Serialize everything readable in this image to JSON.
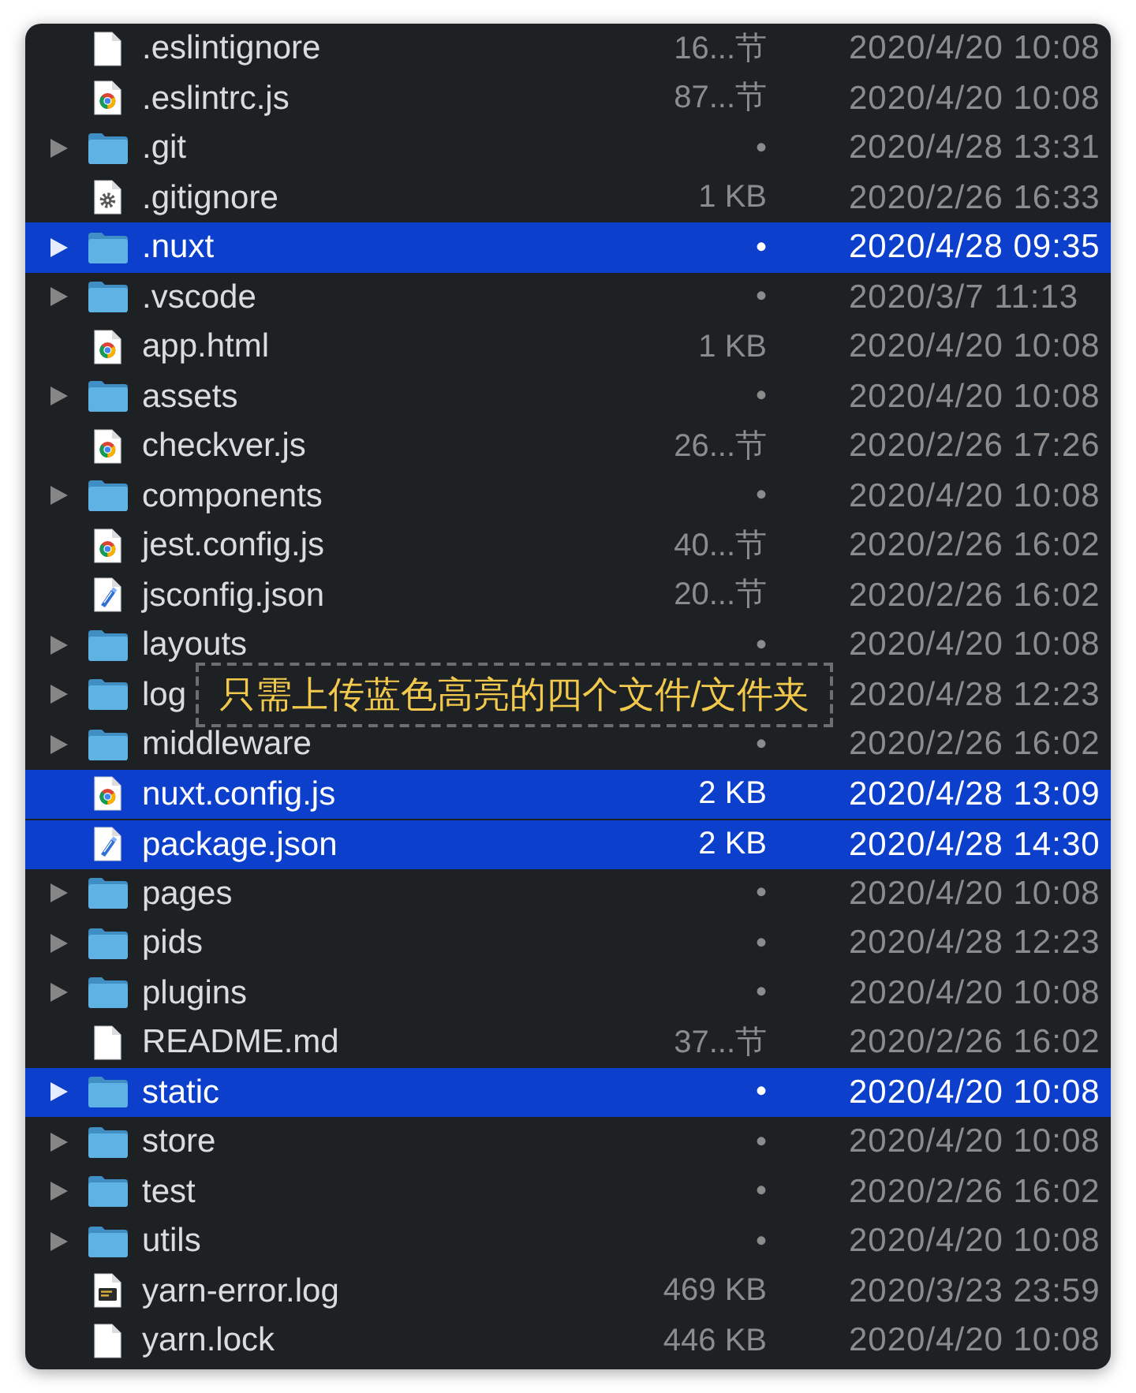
{
  "file_list": {
    "rows": [
      {
        "kind": "plain",
        "name": ".eslintignore",
        "size": "16...节",
        "date": "2020/4/20 10:08",
        "selected": false
      },
      {
        "kind": "script",
        "name": ".eslintrc.js",
        "size": "87...节",
        "date": "2020/4/20 10:08",
        "selected": false
      },
      {
        "kind": "folder",
        "name": ".git",
        "size": "•",
        "date": "2020/4/28 13:31",
        "selected": false,
        "expanded": false
      },
      {
        "kind": "settings",
        "name": ".gitignore",
        "size": "1 KB",
        "date": "2020/2/26 16:33",
        "selected": false
      },
      {
        "kind": "folder",
        "name": ".nuxt",
        "size": "•",
        "date": "2020/4/28 09:35",
        "selected": true,
        "expanded": false
      },
      {
        "kind": "folder",
        "name": ".vscode",
        "size": "•",
        "date": "2020/3/7 11:13",
        "selected": false,
        "expanded": false
      },
      {
        "kind": "script",
        "name": "app.html",
        "size": "1 KB",
        "date": "2020/4/20 10:08",
        "selected": false
      },
      {
        "kind": "folder",
        "name": "assets",
        "size": "•",
        "date": "2020/4/20 10:08",
        "selected": false,
        "expanded": false
      },
      {
        "kind": "script",
        "name": "checkver.js",
        "size": "26...节",
        "date": "2020/2/26 17:26",
        "selected": false
      },
      {
        "kind": "folder",
        "name": "components",
        "size": "•",
        "date": "2020/4/20 10:08",
        "selected": false,
        "expanded": false
      },
      {
        "kind": "script",
        "name": "jest.config.js",
        "size": "40...节",
        "date": "2020/2/26 16:02",
        "selected": false
      },
      {
        "kind": "json",
        "name": "jsconfig.json",
        "size": "20...节",
        "date": "2020/2/26 16:02",
        "selected": false
      },
      {
        "kind": "folder",
        "name": "layouts",
        "size": "•",
        "date": "2020/4/20 10:08",
        "selected": false,
        "expanded": false
      },
      {
        "kind": "folder",
        "name": "log",
        "date": "2020/4/28 12:23",
        "selected": false,
        "expanded": false
      },
      {
        "kind": "folder",
        "name": "middleware",
        "size": "•",
        "date": "2020/2/26 16:02",
        "selected": false,
        "expanded": false
      },
      {
        "kind": "script",
        "name": "nuxt.config.js",
        "size": "2 KB",
        "date": "2020/4/28 13:09",
        "selected": true
      },
      {
        "kind": "json",
        "name": "package.json",
        "size": "2 KB",
        "date": "2020/4/28 14:30",
        "selected": true
      },
      {
        "kind": "folder",
        "name": "pages",
        "size": "•",
        "date": "2020/4/20 10:08",
        "selected": false,
        "expanded": false
      },
      {
        "kind": "folder",
        "name": "pids",
        "size": "•",
        "date": "2020/4/28 12:23",
        "selected": false,
        "expanded": false
      },
      {
        "kind": "folder",
        "name": "plugins",
        "size": "•",
        "date": "2020/4/20 10:08",
        "selected": false,
        "expanded": false
      },
      {
        "kind": "plain",
        "name": "README.md",
        "size": "37...节",
        "date": "2020/2/26 16:02",
        "selected": false
      },
      {
        "kind": "folder",
        "name": "static",
        "size": "•",
        "date": "2020/4/20 10:08",
        "selected": true,
        "expanded": false
      },
      {
        "kind": "folder",
        "name": "store",
        "size": "•",
        "date": "2020/4/20 10:08",
        "selected": false,
        "expanded": false
      },
      {
        "kind": "folder",
        "name": "test",
        "size": "•",
        "date": "2020/2/26 16:02",
        "selected": false,
        "expanded": false
      },
      {
        "kind": "folder",
        "name": "utils",
        "size": "•",
        "date": "2020/4/20 10:08",
        "selected": false,
        "expanded": false
      },
      {
        "kind": "log",
        "name": "yarn-error.log",
        "size": "469 KB",
        "date": "2020/3/23 23:59",
        "selected": false
      },
      {
        "kind": "plain",
        "name": "yarn.lock",
        "size": "446 KB",
        "date": "2020/4/20 10:08",
        "selected": false
      }
    ]
  },
  "annotation": {
    "text": "只需上传蓝色高亮的四个文件/文件夹"
  }
}
